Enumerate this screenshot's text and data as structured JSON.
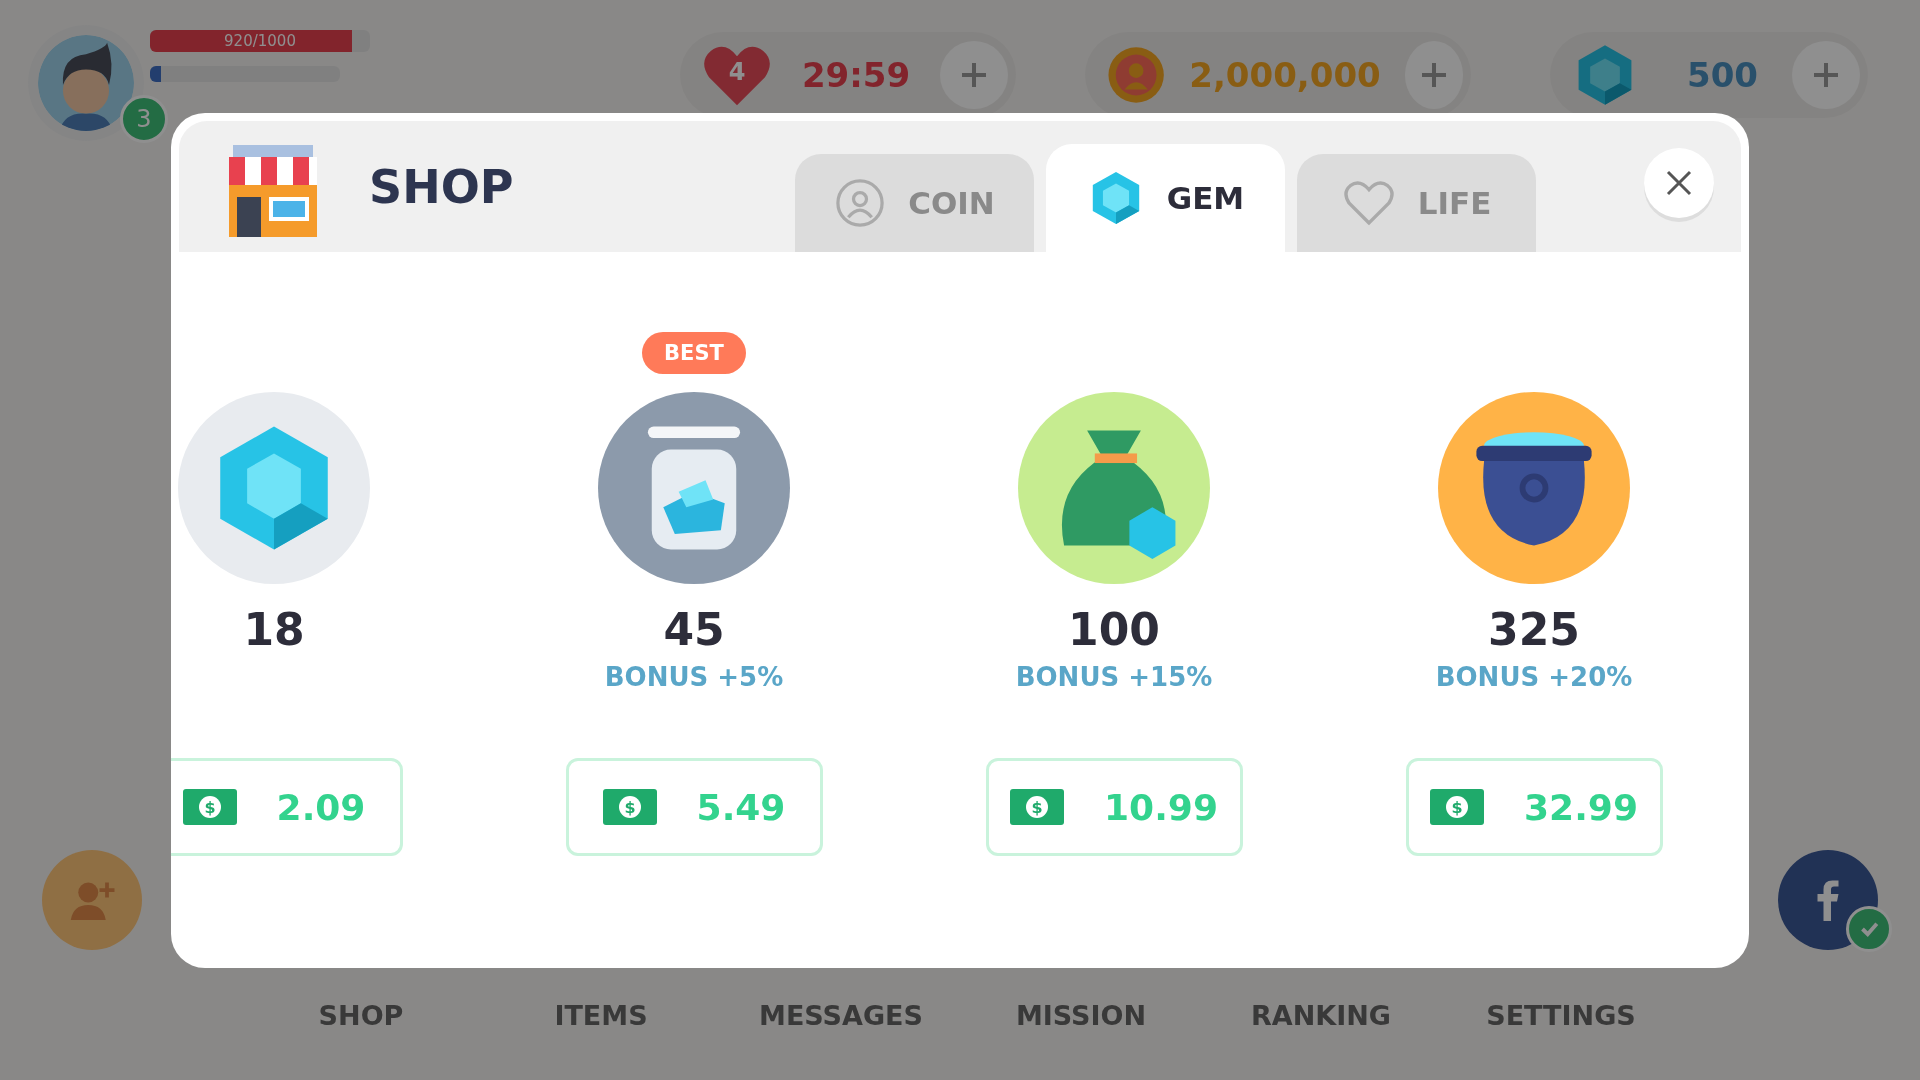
{
  "hud": {
    "xp_bar": {
      "label": "920/1000",
      "level": 0.92
    },
    "progress_bar": {
      "level": 0.06
    },
    "level_badge": "3",
    "lives": {
      "count": "4",
      "timer": "29:59"
    },
    "coins": {
      "amount": "2,000,000"
    },
    "gems": {
      "amount": "500"
    }
  },
  "shop": {
    "title": "SHOP",
    "currency_symbol": "$",
    "tabs": [
      {
        "label": "COIN",
        "kind": "coin",
        "selected": false
      },
      {
        "label": "GEM",
        "kind": "gem",
        "selected": true
      },
      {
        "label": "LIFE",
        "kind": "life",
        "selected": false
      }
    ],
    "packs": [
      {
        "kind": "gem",
        "amount": "18",
        "price": "2.09"
      },
      {
        "kind": "jar",
        "amount": "45",
        "bonus": "BONUS +5%",
        "badge": "BEST",
        "price": "5.49"
      },
      {
        "kind": "bag",
        "amount": "100",
        "bonus": "BONUS +15%",
        "price": "10.99"
      },
      {
        "kind": "pot",
        "amount": "325",
        "bonus": "BONUS +20%",
        "price": "32.99"
      }
    ]
  },
  "nav": [
    "SHOP",
    "ITEMS",
    "MESSAGES",
    "MISSION",
    "RANKING",
    "SETTINGS"
  ]
}
